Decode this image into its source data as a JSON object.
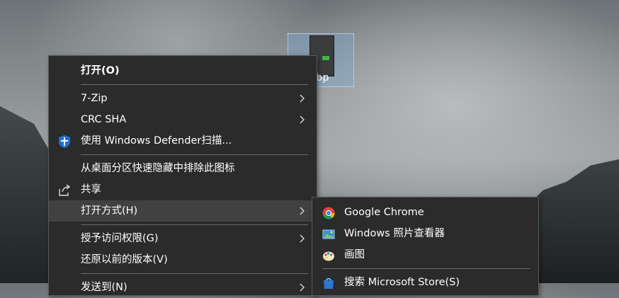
{
  "desktop": {
    "file_label": "ebp"
  },
  "context_menu": {
    "items": [
      {
        "label": "打开(O)"
      },
      {
        "label": "7-Zip"
      },
      {
        "label": "CRC SHA"
      },
      {
        "label": "使用 Windows Defender扫描..."
      },
      {
        "label": "从桌面分区快速隐藏中排除此图标"
      },
      {
        "label": "共享"
      },
      {
        "label": "打开方式(H)"
      },
      {
        "label": "授予访问权限(G)"
      },
      {
        "label": "还原以前的版本(V)"
      },
      {
        "label": "发送到(N)"
      }
    ]
  },
  "open_with_menu": {
    "items": [
      {
        "label": "Google Chrome",
        "icon": "chrome-icon"
      },
      {
        "label": "Windows 照片查看器",
        "icon": "photo-viewer-icon"
      },
      {
        "label": "画图",
        "icon": "paint-icon"
      },
      {
        "label": "搜索 Microsoft Store(S)",
        "icon": "store-icon"
      }
    ]
  },
  "colors": {
    "menu_bg": "#2b2b2b",
    "menu_hover": "#414141",
    "defender_blue": "#1e6fd9"
  }
}
